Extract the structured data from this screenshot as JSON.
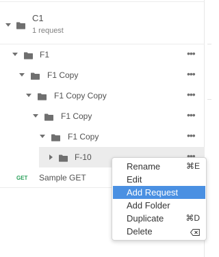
{
  "collection": {
    "name": "C1",
    "request_count": "1 request"
  },
  "tree": [
    {
      "label": "F1",
      "expanded": true
    },
    {
      "label": "F1 Copy",
      "expanded": true
    },
    {
      "label": "F1 Copy Copy",
      "expanded": true
    },
    {
      "label": "F1 Copy",
      "expanded": true
    },
    {
      "label": "F1 Copy",
      "expanded": true
    },
    {
      "label": "F-10",
      "expanded": false,
      "highlighted": true
    }
  ],
  "request": {
    "method": "GET",
    "name": "Sample GET"
  },
  "more_icon": "•••",
  "context_menu": {
    "items": [
      {
        "label": "Rename",
        "shortcut": "⌘E"
      },
      {
        "label": "Edit",
        "shortcut": ""
      },
      {
        "label": "Add Request",
        "shortcut": "",
        "active": true
      },
      {
        "label": "Add Folder",
        "shortcut": ""
      },
      {
        "label": "Duplicate",
        "shortcut": "⌘D"
      },
      {
        "label": "Delete",
        "shortcut": "backspace-icon"
      }
    ]
  },
  "colors": {
    "selected_menu_item": "#4a90e2",
    "get_method": "#2aa05a",
    "row_highlight": "#ececec"
  }
}
